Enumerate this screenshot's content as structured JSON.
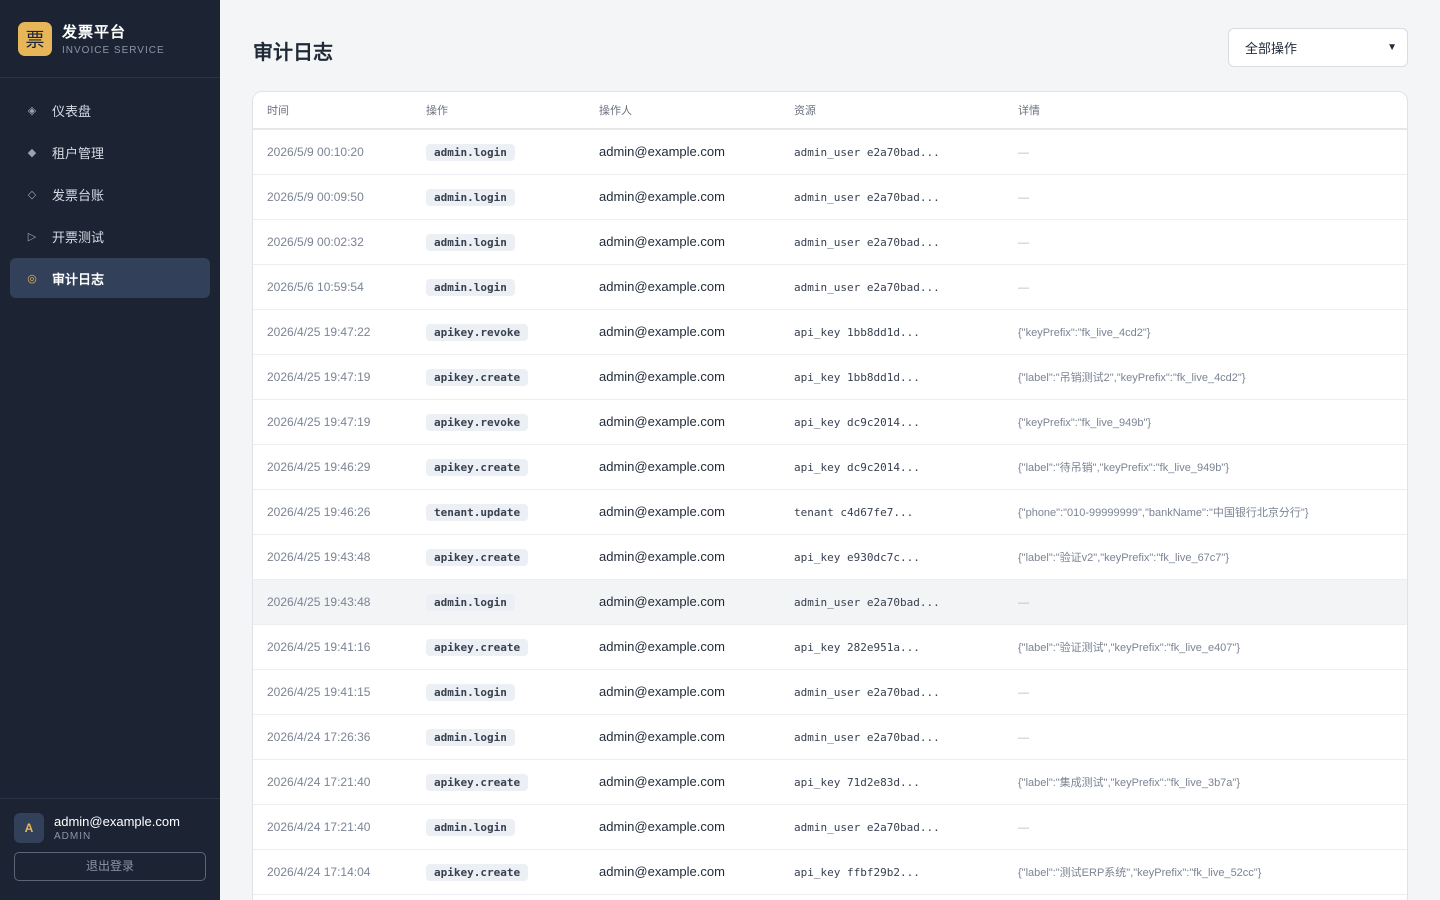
{
  "brand": {
    "logo_char": "票",
    "title": "发票平台",
    "subtitle": "INVOICE SERVICE"
  },
  "nav": [
    {
      "icon": "diamond-small-icon",
      "glyph": "◈",
      "label": "仪表盘",
      "active": false
    },
    {
      "icon": "diamond-solid-icon",
      "glyph": "◆",
      "label": "租户管理",
      "active": false
    },
    {
      "icon": "diamond-outline-icon",
      "glyph": "◇",
      "label": "发票台账",
      "active": false
    },
    {
      "icon": "play-outline-icon",
      "glyph": "▷",
      "label": "开票测试",
      "active": false
    },
    {
      "icon": "target-icon",
      "glyph": "◎",
      "label": "审计日志",
      "active": true
    }
  ],
  "user": {
    "avatar_letter": "A",
    "email": "admin@example.com",
    "role": "ADMIN",
    "logout_label": "退出登录"
  },
  "page": {
    "title": "审计日志",
    "filter_value": "全部操作"
  },
  "table": {
    "headers": {
      "time": "时间",
      "action": "操作",
      "operator": "操作人",
      "resource": "资源",
      "detail": "详情"
    },
    "rows": [
      {
        "time": "2026/5/9 00:10:20",
        "action": "admin.login",
        "operator": "admin@example.com",
        "resource": "admin_user e2a70bad...",
        "detail": "—"
      },
      {
        "time": "2026/5/9 00:09:50",
        "action": "admin.login",
        "operator": "admin@example.com",
        "resource": "admin_user e2a70bad...",
        "detail": "—"
      },
      {
        "time": "2026/5/9 00:02:32",
        "action": "admin.login",
        "operator": "admin@example.com",
        "resource": "admin_user e2a70bad...",
        "detail": "—"
      },
      {
        "time": "2026/5/6 10:59:54",
        "action": "admin.login",
        "operator": "admin@example.com",
        "resource": "admin_user e2a70bad...",
        "detail": "—"
      },
      {
        "time": "2026/4/25 19:47:22",
        "action": "apikey.revoke",
        "operator": "admin@example.com",
        "resource": "api_key 1bb8dd1d...",
        "detail": "{\"keyPrefix\":\"fk_live_4cd2\"}"
      },
      {
        "time": "2026/4/25 19:47:19",
        "action": "apikey.create",
        "operator": "admin@example.com",
        "resource": "api_key 1bb8dd1d...",
        "detail": "{\"label\":\"吊销测试2\",\"keyPrefix\":\"fk_live_4cd2\"}"
      },
      {
        "time": "2026/4/25 19:47:19",
        "action": "apikey.revoke",
        "operator": "admin@example.com",
        "resource": "api_key dc9c2014...",
        "detail": "{\"keyPrefix\":\"fk_live_949b\"}"
      },
      {
        "time": "2026/4/25 19:46:29",
        "action": "apikey.create",
        "operator": "admin@example.com",
        "resource": "api_key dc9c2014...",
        "detail": "{\"label\":\"待吊销\",\"keyPrefix\":\"fk_live_949b\"}"
      },
      {
        "time": "2026/4/25 19:46:26",
        "action": "tenant.update",
        "operator": "admin@example.com",
        "resource": "tenant c4d67fe7...",
        "detail": "{\"phone\":\"010-99999999\",\"bankName\":\"中国银行北京分行\"}"
      },
      {
        "time": "2026/4/25 19:43:48",
        "action": "apikey.create",
        "operator": "admin@example.com",
        "resource": "api_key e930dc7c...",
        "detail": "{\"label\":\"验证v2\",\"keyPrefix\":\"fk_live_67c7\"}"
      },
      {
        "time": "2026/4/25 19:43:48",
        "action": "admin.login",
        "operator": "admin@example.com",
        "resource": "admin_user e2a70bad...",
        "detail": "—",
        "highlighted": true
      },
      {
        "time": "2026/4/25 19:41:16",
        "action": "apikey.create",
        "operator": "admin@example.com",
        "resource": "api_key 282e951a...",
        "detail": "{\"label\":\"验证测试\",\"keyPrefix\":\"fk_live_e407\"}"
      },
      {
        "time": "2026/4/25 19:41:15",
        "action": "admin.login",
        "operator": "admin@example.com",
        "resource": "admin_user e2a70bad...",
        "detail": "—"
      },
      {
        "time": "2026/4/24 17:26:36",
        "action": "admin.login",
        "operator": "admin@example.com",
        "resource": "admin_user e2a70bad...",
        "detail": "—"
      },
      {
        "time": "2026/4/24 17:21:40",
        "action": "apikey.create",
        "operator": "admin@example.com",
        "resource": "api_key 71d2e83d...",
        "detail": "{\"label\":\"集成测试\",\"keyPrefix\":\"fk_live_3b7a\"}"
      },
      {
        "time": "2026/4/24 17:21:40",
        "action": "admin.login",
        "operator": "admin@example.com",
        "resource": "admin_user e2a70bad...",
        "detail": "—"
      },
      {
        "time": "2026/4/24 17:14:04",
        "action": "apikey.create",
        "operator": "admin@example.com",
        "resource": "api_key ffbf29b2...",
        "detail": "{\"label\":\"测试ERP系统\",\"keyPrefix\":\"fk_live_52cc\"}"
      }
    ]
  },
  "colors": {
    "sidebar_bg": "#1c2434",
    "accent": "#e7b659",
    "active_bg": "#33405a",
    "page_bg": "#f4f5f7"
  }
}
